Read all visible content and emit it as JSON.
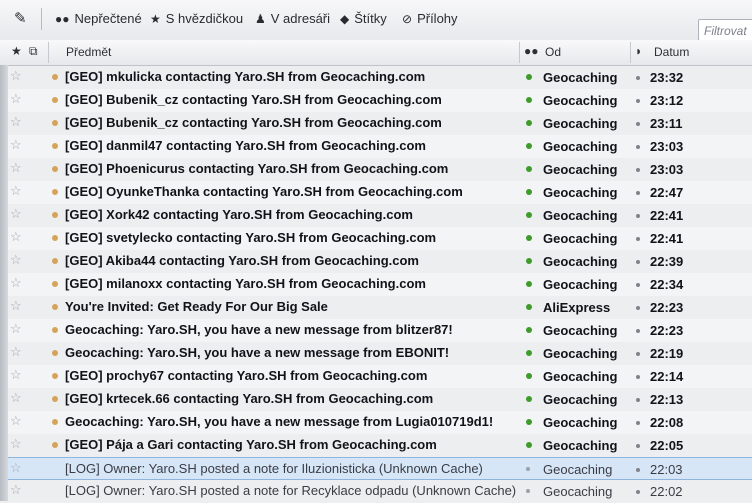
{
  "toolbar": {
    "items": [
      {
        "label": "Nepřečtené",
        "icon": "unread-icon"
      },
      {
        "label": "S hvězdičkou",
        "icon": "star-icon"
      },
      {
        "label": "V adresáři",
        "icon": "contact-icon"
      },
      {
        "label": "Štítky",
        "icon": "tag-icon"
      },
      {
        "label": "Přílohy",
        "icon": "attachment-icon"
      }
    ],
    "filter_placeholder": "Filtrovat"
  },
  "columns": {
    "subject": "Předmět",
    "from": "Od",
    "date": "Datum"
  },
  "messages": [
    {
      "subject": "[GEO] mkulicka contacting Yaro.SH from Geocaching.com",
      "from": "Geocaching",
      "date": "23:32"
    },
    {
      "subject": "[GEO] Bubenik_cz contacting Yaro.SH from Geocaching.com",
      "from": "Geocaching",
      "date": "23:12"
    },
    {
      "subject": "[GEO] Bubenik_cz contacting Yaro.SH from Geocaching.com",
      "from": "Geocaching",
      "date": "23:11"
    },
    {
      "subject": "[GEO] danmil47 contacting Yaro.SH from Geocaching.com",
      "from": "Geocaching",
      "date": "23:03"
    },
    {
      "subject": "[GEO] Phoenicurus contacting Yaro.SH from Geocaching.com",
      "from": "Geocaching",
      "date": "23:03"
    },
    {
      "subject": "[GEO] OyunkeThanka contacting Yaro.SH from Geocaching.com",
      "from": "Geocaching",
      "date": "22:47"
    },
    {
      "subject": "[GEO] Xork42 contacting Yaro.SH from Geocaching.com",
      "from": "Geocaching",
      "date": "22:41"
    },
    {
      "subject": "[GEO] svetylecko contacting Yaro.SH from Geocaching.com",
      "from": "Geocaching",
      "date": "22:41"
    },
    {
      "subject": "[GEO] Akiba44 contacting Yaro.SH from Geocaching.com",
      "from": "Geocaching",
      "date": "22:39"
    },
    {
      "subject": "[GEO] milanoxx contacting Yaro.SH from Geocaching.com",
      "from": "Geocaching",
      "date": "22:34"
    },
    {
      "subject": "You're Invited: Get Ready For Our Big Sale",
      "from": "AliExpress",
      "date": "22:23"
    },
    {
      "subject": "Geocaching: Yaro.SH, you have a new message from blitzer87!",
      "from": "Geocaching",
      "date": "22:23"
    },
    {
      "subject": "Geocaching: Yaro.SH, you have a new message from EBONIT!",
      "from": "Geocaching",
      "date": "22:19"
    },
    {
      "subject": "[GEO] prochy67 contacting Yaro.SH from Geocaching.com",
      "from": "Geocaching",
      "date": "22:14"
    },
    {
      "subject": "[GEO] krtecek.66 contacting Yaro.SH from Geocaching.com",
      "from": "Geocaching",
      "date": "22:13"
    },
    {
      "subject": "Geocaching: Yaro.SH, you have a new message from Lugia010719d1!",
      "from": "Geocaching",
      "date": "22:08"
    },
    {
      "subject": "[GEO] Pája a Gari contacting Yaro.SH from Geocaching.com",
      "from": "Geocaching",
      "date": "22:05"
    },
    {
      "subject": "[LOG] Owner: Yaro.SH posted a note for Iluzionisticka (Unknown Cache)",
      "from": "Geocaching",
      "date": "22:03"
    },
    {
      "subject": "[LOG] Owner: Yaro.SH posted a note for Recyklace odpadu (Unknown Cache)",
      "from": "Geocaching",
      "date": "22:02"
    }
  ]
}
